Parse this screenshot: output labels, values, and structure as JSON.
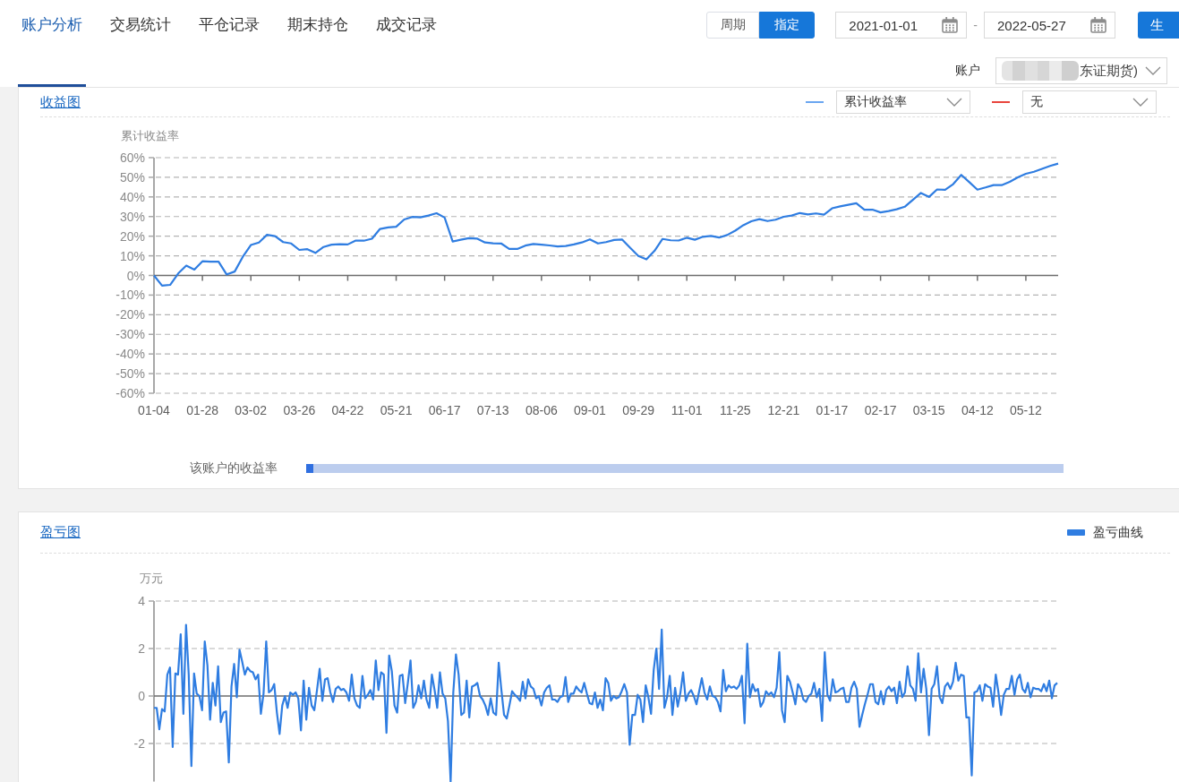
{
  "nav_tabs": [
    {
      "label": "账户分析",
      "selected": true
    },
    {
      "label": "交易统计",
      "selected": false
    },
    {
      "label": "平仓记录",
      "selected": false
    },
    {
      "label": "期末持仓",
      "selected": false
    },
    {
      "label": "成交记录",
      "selected": false
    }
  ],
  "range_mode": [
    {
      "label": "周期",
      "selected": false
    },
    {
      "label": "指定",
      "selected": true
    }
  ],
  "date_range": {
    "start": "2021-01-01",
    "separator": "-",
    "end": "2022-05-27"
  },
  "generate_button": "生",
  "account": {
    "label": "账户",
    "value": "东证期货)"
  },
  "return_chart": {
    "title": "收益图",
    "legend": [
      {
        "color": "#6aa6f0",
        "value": "累计收益率"
      },
      {
        "color": "#e8453c",
        "value": "无"
      }
    ],
    "chart_data": {
      "type": "line",
      "ylabel": "累计收益率",
      "grid": true,
      "ylim": [
        -60,
        60
      ],
      "categories": [
        "01-04",
        null,
        null,
        null,
        null,
        null,
        "01-28",
        null,
        null,
        null,
        null,
        null,
        "03-02",
        null,
        null,
        null,
        null,
        null,
        "03-26",
        null,
        null,
        null,
        null,
        null,
        "04-22",
        null,
        null,
        null,
        null,
        null,
        "05-21",
        null,
        null,
        null,
        null,
        null,
        "06-17",
        null,
        null,
        null,
        null,
        null,
        "07-13",
        null,
        null,
        null,
        null,
        null,
        "08-06",
        null,
        null,
        null,
        null,
        null,
        "09-01",
        null,
        null,
        null,
        null,
        null,
        "09-29",
        null,
        null,
        null,
        null,
        null,
        "11-01",
        null,
        null,
        null,
        null,
        null,
        "11-25",
        null,
        null,
        null,
        null,
        null,
        "12-21",
        null,
        null,
        null,
        null,
        null,
        "01-17",
        null,
        null,
        null,
        null,
        null,
        "02-17",
        null,
        null,
        null,
        null,
        null,
        "03-15",
        null,
        null,
        null,
        null,
        null,
        "04-12",
        null,
        null,
        null,
        null,
        null,
        "05-12",
        null,
        null,
        null,
        null
      ],
      "yticks": [
        {
          "value": 60,
          "label": "60%"
        },
        {
          "value": 50,
          "label": "50%"
        },
        {
          "value": 40,
          "label": "40%"
        },
        {
          "value": 30,
          "label": "30%"
        },
        {
          "value": 20,
          "label": "20%"
        },
        {
          "value": 10,
          "label": "10%"
        },
        {
          "value": 0,
          "label": "0%"
        },
        {
          "value": -10,
          "label": "-10%"
        },
        {
          "value": -20,
          "label": "-20%"
        },
        {
          "value": -30,
          "label": "-30%"
        },
        {
          "value": -40,
          "label": "-40%"
        },
        {
          "value": -50,
          "label": "-50%"
        },
        {
          "value": -60,
          "label": "-60%"
        }
      ],
      "series": [
        {
          "color": "#2f7de1",
          "values": [
            0,
            -5.2,
            -4.8,
            1,
            5,
            3,
            7.2,
            7,
            7,
            0.5,
            2,
            9.5,
            15.5,
            16.8,
            20.7,
            20,
            17,
            16.3,
            13,
            13.4,
            11.5,
            14.5,
            15.7,
            15.9,
            15.8,
            17.8,
            17.7,
            18.7,
            23.7,
            24.5,
            24.8,
            28.5,
            29.8,
            29.6,
            30.5,
            31.7,
            29.5,
            17.3,
            18.2,
            19,
            18.8,
            16.8,
            16.4,
            16.3,
            13.5,
            13.5,
            15.2,
            16,
            15.7,
            15.3,
            14.8,
            15,
            15.8,
            16.8,
            18.4,
            16.3,
            17,
            18.1,
            18.3,
            14,
            9.9,
            8.2,
            12.5,
            18.6,
            17.9,
            17.8,
            19.2,
            18.2,
            19.7,
            20.1,
            19.3,
            20.6,
            22.8,
            25.6,
            27.6,
            28.7,
            27.7,
            28.4,
            29.9,
            30.5,
            31.8,
            31.1,
            31.6,
            31,
            34.2,
            35.2,
            36,
            36.8,
            33.5,
            33.5,
            32.1,
            32.8,
            33.7,
            35,
            38.5,
            42,
            40,
            43.8,
            43.6,
            46.5,
            51.2,
            47.5,
            43.7,
            44.8,
            46,
            46,
            47.7,
            50,
            51.8,
            52.8,
            54.3,
            55.8,
            57
          ]
        }
      ]
    },
    "account_bar": {
      "label": "该账户的收益率",
      "level": 0.01
    }
  },
  "pnl_chart": {
    "title": "盈亏图",
    "chart_data": {
      "type": "line",
      "ylabel": "万元",
      "grid": true,
      "ylim": [
        -3.6,
        4
      ],
      "yticks": [
        4,
        2,
        0,
        -2
      ],
      "series": [
        {
          "name": "盈亏曲线",
          "color": "#2f7de1",
          "values": [
            -0.5,
            -0.5,
            -1.4,
            -0.55,
            -0.65,
            0.9,
            1.2,
            -2.15,
            0.95,
            0.9,
            2.6,
            -0.75,
            3.0,
            0.9,
            -2.95,
            0.95,
            0.1,
            0,
            -0.6,
            2.3,
            1.3,
            -1.0,
            0.55,
            -0.4,
            1.25,
            -1.1,
            -0.7,
            -0.65,
            -2.8,
            0.4,
            1.35,
            -0.05,
            1.95,
            1.45,
            0.9,
            1.2,
            1.05,
            1.0,
            0.7,
            0.9,
            -0.75,
            0.1,
            2.3,
            0.15,
            0.25,
            0.5,
            -0.7,
            -1.6,
            -0.4,
            0,
            -0.5,
            0.15,
            0.05,
            0.15,
            -0.1,
            -1.45,
            0.65,
            -1.0,
            0.35,
            -0.4,
            -0.6,
            0.25,
            1.15,
            -0.2,
            0.7,
            0.75,
            0.15,
            -0.25,
            0.3,
            0.4,
            0.25,
            0.3,
            0.15,
            -0.2,
            0.9,
            -0.1,
            -0.4,
            -0.5,
            0.85,
            -0.1,
            0.05,
            0.25,
            -0.15,
            1.5,
            0.25,
            1.0,
            0.9,
            -1.55,
            1.7,
            1.05,
            -0.4,
            -0.7,
            0.85,
            0.9,
            -0.3,
            0.55,
            1.5,
            -0.5,
            -0.25,
            0.45,
            -0.1,
            0.65,
            -0.15,
            -0.5,
            0.9,
            0.25,
            -0.5,
            1.0,
            0.1,
            -0.1,
            -1.05,
            -3.6,
            0.15,
            1.75,
            0.9,
            -0.8,
            -0.7,
            0.65,
            -0.9,
            0.4,
            0.45,
            0.55,
            0,
            -0.15,
            -0.4,
            -0.8,
            -0.1,
            -0.7,
            -0.8,
            1.4,
            0.25,
            -0.8,
            -0.95,
            -0.4,
            0.2,
            0.05,
            -0.05,
            -0.2,
            0.6,
            -0.1,
            0.7,
            0.4,
            0.3,
            -0.1,
            0,
            -0.4,
            0.15,
            0.35,
            0.45,
            -0.15,
            -0.15,
            -0.25,
            -0.05,
            0,
            0.8,
            -0.25,
            0.1,
            0.1,
            0.4,
            0.25,
            0.15,
            0.55,
            0.1,
            -0.3,
            -0.35,
            0.15,
            -0.5,
            -0.15,
            -0.6,
            0.75,
            0.55,
            -0.2,
            0,
            -0.1,
            -0.05,
            0.2,
            0.5,
            0.15,
            -2.05,
            -0.8,
            -0.8,
            0.05,
            -0.15,
            -1.1,
            0.45,
            -0.05,
            -0.75,
            1.1,
            2.0,
            0.3,
            2.8,
            -0.5,
            -0.05,
            0.85,
            -0.8,
            0.35,
            -0.45,
            0.15,
            1.0,
            -0.2,
            0.1,
            0.25,
            0,
            -0.35,
            0.2,
            0.75,
            0.15,
            -0.15,
            0.4,
            0,
            -0.05,
            -0.25,
            -0.65,
            1.1,
            0.2,
            0.45,
            0.35,
            0.4,
            0.3,
            0.45,
            0.85,
            -1.15,
            2.2,
            -0.05,
            0.5,
            0.2,
            0.3,
            -0.45,
            -0.25,
            0.2,
            0.05,
            0.15,
            -0.05,
            0.35,
            1.85,
            -0.6,
            -1.1,
            0.85,
            0.6,
            0.15,
            -0.35,
            0.5,
            0.3,
            -0.15,
            -0.25,
            0,
            0.1,
            0.55,
            -0.05,
            0.3,
            -1.05,
            1.85,
            0.05,
            -0.2,
            0.7,
            0.15,
            0.2,
            0.3,
            0.35,
            -0.25,
            -0.25,
            0.35,
            0.6,
            0.3,
            -1.3,
            -0.8,
            -0.35,
            0.05,
            0.5,
            0.5,
            -0.25,
            -0.35,
            0.2,
            -0.35,
            0.25,
            0.4,
            0.2,
            0.35,
            -0.3,
            0.6,
            -0.05,
            0.15,
            1.25,
            0.45,
            0.3,
            -0.2,
            1.8,
            0.15,
            1.15,
            0.3,
            -1.65,
            0.3,
            0.5,
            1.25,
            -0.05,
            -0.3,
            0.4,
            0.55,
            0.3,
            0.6,
            1.4,
            0.65,
            0.9,
            0.85,
            -0.9,
            -0.9,
            -3.35,
            0.15,
            0.2,
            0.45,
            -0.2,
            0.5,
            0.4,
            0.35,
            -0.45,
            0.9,
            0.15,
            -0.8,
            0.05,
            0.3,
            0.3,
            0.85,
            0.05,
            0.7,
            0.9,
            0.3,
            0.15,
            0.55,
            -0.05,
            0.35,
            0.3,
            0.3,
            0.2,
            0.5,
            0.2,
            0.65,
            -0.1,
            0.45,
            0.55
          ]
        }
      ]
    }
  }
}
